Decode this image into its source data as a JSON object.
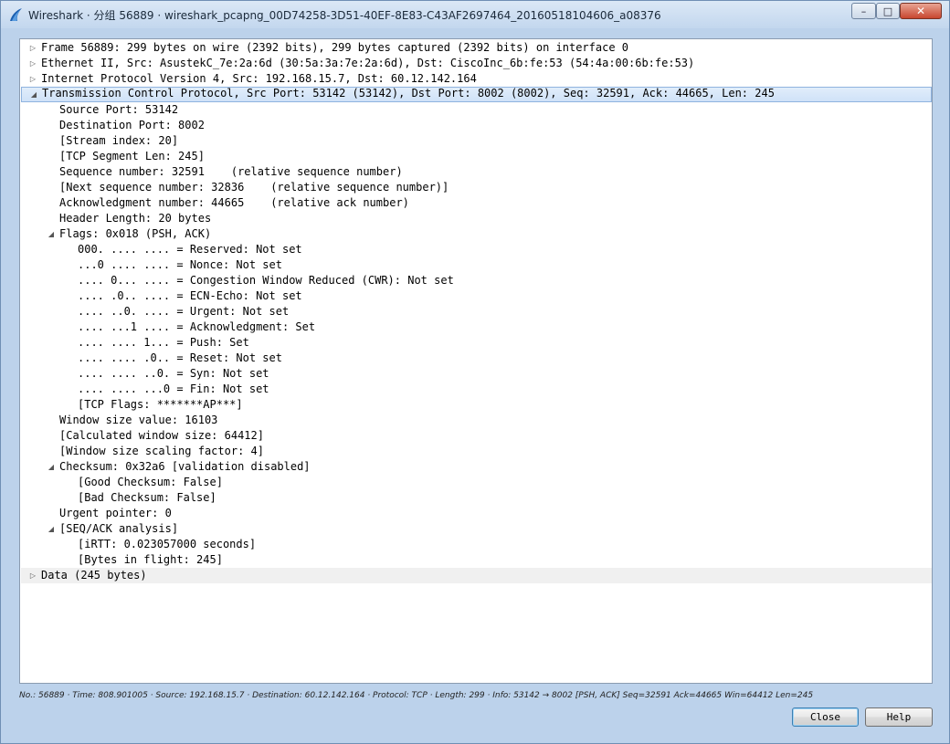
{
  "window": {
    "title": "Wireshark · 分组 56889 · wireshark_pcapng_00D74258-3D51-40EF-8E83-C43AF2697464_20160518104606_a08376",
    "min_icon": "minimize-icon",
    "max_icon": "maximize-icon",
    "close_icon": "close-icon",
    "min_glyph": "–",
    "max_glyph": "□",
    "close_glyph": "✕"
  },
  "tree": {
    "rows": [
      {
        "text": "Frame 56889: 299 bytes on wire (2392 bits), 299 bytes captured (2392 bits) on interface 0",
        "arrow": "▷"
      },
      {
        "text": "Ethernet II, Src: AsustekC_7e:2a:6d (30:5a:3a:7e:2a:6d), Dst: CiscoInc_6b:fe:53 (54:4a:00:6b:fe:53)",
        "arrow": "▷"
      },
      {
        "text": "Internet Protocol Version 4, Src: 192.168.15.7, Dst: 60.12.142.164",
        "arrow": "▷"
      },
      {
        "text": "Transmission Control Protocol, Src Port: 53142 (53142), Dst Port: 8002 (8002), Seq: 32591, Ack: 44665, Len: 245",
        "arrow": "◢"
      },
      {
        "text": "Source Port: 53142",
        "arrow": ""
      },
      {
        "text": "Destination Port: 8002",
        "arrow": ""
      },
      {
        "text": "[Stream index: 20]",
        "arrow": ""
      },
      {
        "text": "[TCP Segment Len: 245]",
        "arrow": ""
      },
      {
        "text": "Sequence number: 32591    (relative sequence number)",
        "arrow": ""
      },
      {
        "text": "[Next sequence number: 32836    (relative sequence number)]",
        "arrow": ""
      },
      {
        "text": "Acknowledgment number: 44665    (relative ack number)",
        "arrow": ""
      },
      {
        "text": "Header Length: 20 bytes",
        "arrow": ""
      },
      {
        "text": "Flags: 0x018 (PSH, ACK)",
        "arrow": "◢"
      },
      {
        "text": "000. .... .... = Reserved: Not set",
        "arrow": ""
      },
      {
        "text": "...0 .... .... = Nonce: Not set",
        "arrow": ""
      },
      {
        "text": ".... 0... .... = Congestion Window Reduced (CWR): Not set",
        "arrow": ""
      },
      {
        "text": ".... .0.. .... = ECN-Echo: Not set",
        "arrow": ""
      },
      {
        "text": ".... ..0. .... = Urgent: Not set",
        "arrow": ""
      },
      {
        "text": ".... ...1 .... = Acknowledgment: Set",
        "arrow": ""
      },
      {
        "text": ".... .... 1... = Push: Set",
        "arrow": ""
      },
      {
        "text": ".... .... .0.. = Reset: Not set",
        "arrow": ""
      },
      {
        "text": ".... .... ..0. = Syn: Not set",
        "arrow": ""
      },
      {
        "text": ".... .... ...0 = Fin: Not set",
        "arrow": ""
      },
      {
        "text": "[TCP Flags: *******AP***]",
        "arrow": ""
      },
      {
        "text": "Window size value: 16103",
        "arrow": ""
      },
      {
        "text": "[Calculated window size: 64412]",
        "arrow": ""
      },
      {
        "text": "[Window size scaling factor: 4]",
        "arrow": ""
      },
      {
        "text": "Checksum: 0x32a6 [validation disabled]",
        "arrow": "◢"
      },
      {
        "text": "[Good Checksum: False]",
        "arrow": ""
      },
      {
        "text": "[Bad Checksum: False]",
        "arrow": ""
      },
      {
        "text": "Urgent pointer: 0",
        "arrow": ""
      },
      {
        "text": "[SEQ/ACK analysis]",
        "arrow": "◢"
      },
      {
        "text": "[iRTT: 0.023057000 seconds]",
        "arrow": ""
      },
      {
        "text": "[Bytes in flight: 245]",
        "arrow": ""
      },
      {
        "text": "Data (245 bytes)",
        "arrow": "▷"
      }
    ]
  },
  "status_line": "No.: 56889 · Time: 808.901005 · Source: 192.168.15.7 · Destination: 60.12.142.164 · Protocol: TCP · Length: 299 · Info: 53142 → 8002 [PSH, ACK] Seq=32591 Ack=44665 Win=64412 Len=245",
  "buttons": {
    "close_label": "Close",
    "help_label": "Help"
  }
}
